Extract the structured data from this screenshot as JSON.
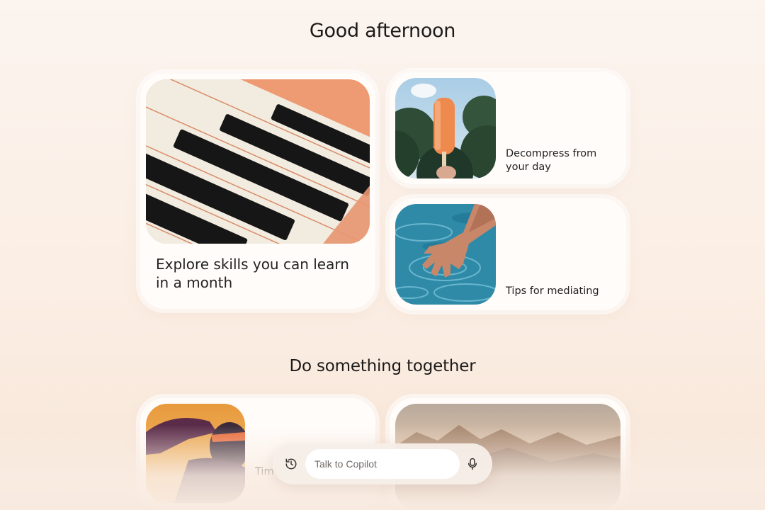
{
  "greeting": "Good afternoon",
  "cards": {
    "skills": {
      "label": "Explore skills you can learn in a month",
      "image_icon": "piano-keys-image"
    },
    "decompress": {
      "label": "Decompress from your day",
      "image_icon": "popsicle-image"
    },
    "mediating": {
      "label": "Tips for mediating",
      "image_icon": "hand-in-water-image"
    }
  },
  "section": {
    "title": "Do something together"
  },
  "bottom_cards": {
    "left": {
      "label": "Tim",
      "image_icon": "runner-image"
    },
    "right": {
      "image_icon": "mountains-image"
    }
  },
  "composer": {
    "placeholder": "Talk to Copilot",
    "history_icon": "history-icon",
    "mic_icon": "microphone-icon"
  }
}
